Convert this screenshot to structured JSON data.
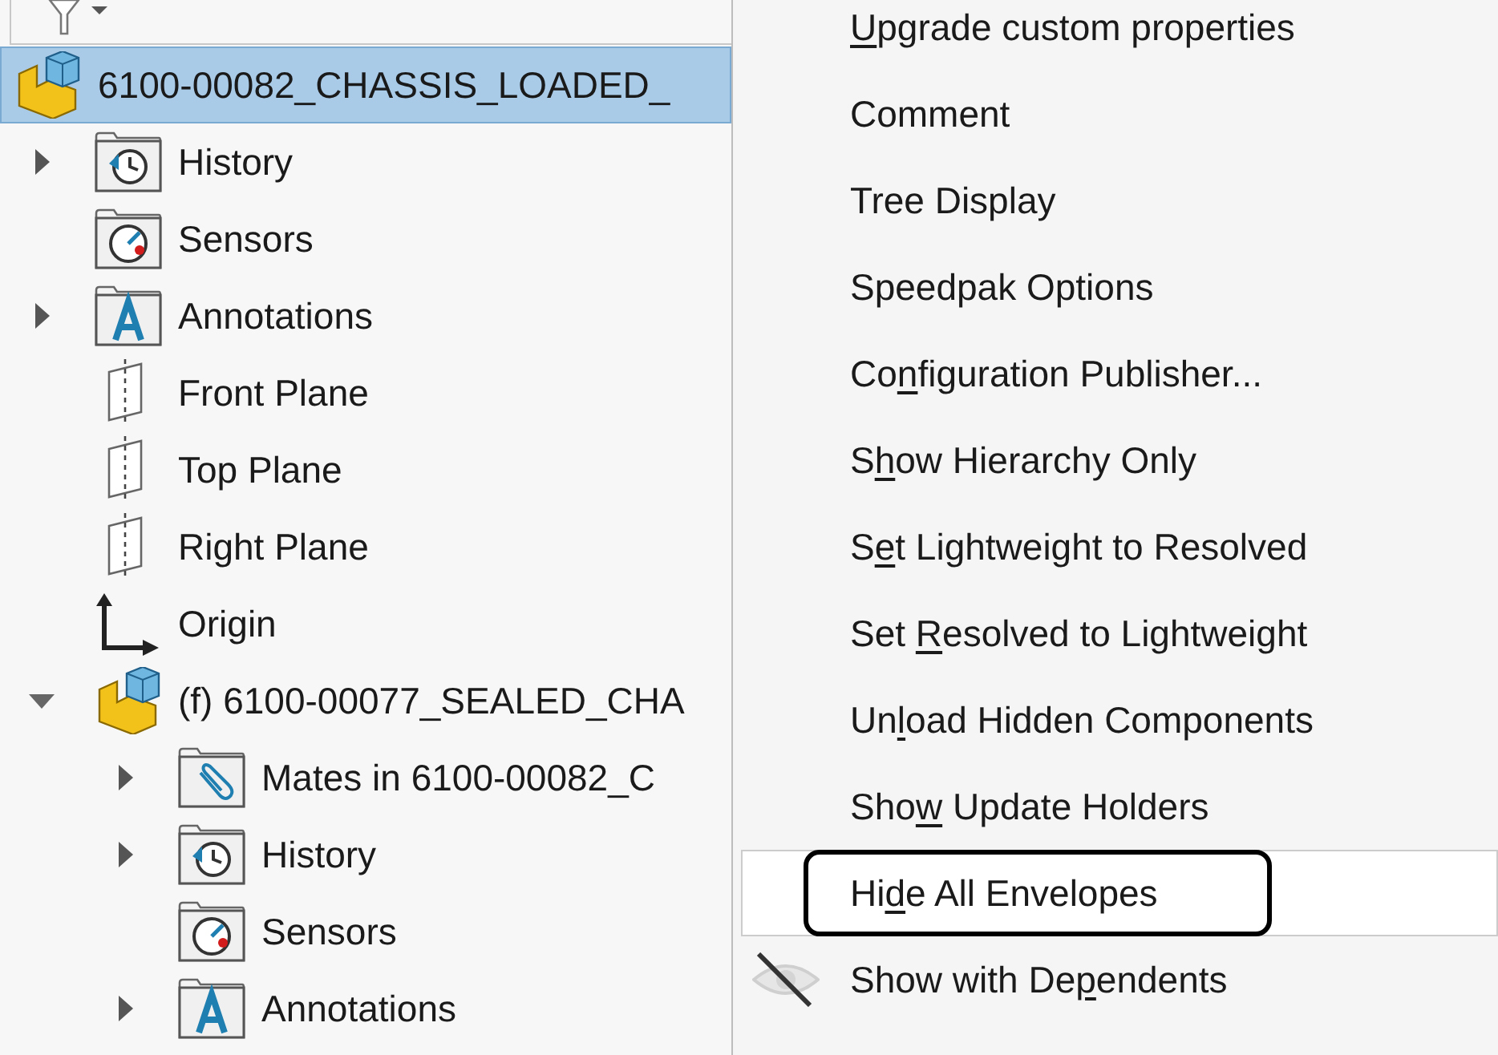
{
  "tree": {
    "label": "6100-00082_CHASSIS_LOADED_",
    "kind": "assembly",
    "selected": true,
    "children": [
      {
        "label": "History",
        "kind": "history",
        "expanded": false,
        "selected": false
      },
      {
        "label": "Sensors",
        "kind": "sensors",
        "selected": false
      },
      {
        "label": "Annotations",
        "kind": "annotations",
        "expanded": false,
        "selected": false
      },
      {
        "label": "Front Plane",
        "kind": "plane",
        "selected": false
      },
      {
        "label": "Top Plane",
        "kind": "plane",
        "selected": false
      },
      {
        "label": "Right Plane",
        "kind": "plane",
        "selected": false
      },
      {
        "label": "Origin",
        "kind": "origin",
        "selected": false
      },
      {
        "label": "(f) 6100-00077_SEALED_CHA",
        "kind": "assembly",
        "expanded": true,
        "selected": false,
        "children": [
          {
            "label": "Mates in 6100-00082_C",
            "kind": "mates",
            "expanded": false,
            "selected": false
          },
          {
            "label": "History",
            "kind": "history",
            "expanded": false,
            "selected": false
          },
          {
            "label": "Sensors",
            "kind": "sensors",
            "selected": false
          },
          {
            "label": "Annotations",
            "kind": "annotations",
            "expanded": false,
            "selected": false
          }
        ]
      }
    ]
  },
  "context_menu": [
    {
      "key": "U",
      "after": "pgrade custom properties",
      "selected": false
    },
    {
      "before": "Comment",
      "selected": false
    },
    {
      "before": "Tree Display",
      "selected": false
    },
    {
      "before": "Speedpak Options",
      "selected": false
    },
    {
      "before": "Co",
      "key": "n",
      "after": "figuration Publisher...",
      "selected": false
    },
    {
      "before": "S",
      "key": "h",
      "after": "ow Hierarchy Only",
      "selected": false
    },
    {
      "before": "S",
      "key": "e",
      "after": "t Lightweight to Resolved",
      "selected": false
    },
    {
      "before": "Set ",
      "key": "R",
      "after": "esolved to Lightweight",
      "selected": false
    },
    {
      "before": "Un",
      "key": "l",
      "after": "oad Hidden Components",
      "selected": false
    },
    {
      "before": "Sho",
      "key": "w",
      "after": " Update Holders",
      "selected": false
    },
    {
      "before": "Hi",
      "key": "d",
      "after": "e All Envelopes",
      "selected": true,
      "outlined": true
    },
    {
      "before": "Show with De",
      "key": "p",
      "after": "endents",
      "selected": false,
      "kind": "eye-slash"
    }
  ]
}
